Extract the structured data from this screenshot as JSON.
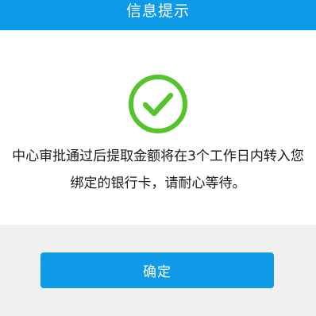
{
  "dialog": {
    "title": "信息提示",
    "icon": "success-check-icon",
    "message_line1": "中心审批通过后提取金额将在3个工作日内转入您",
    "message_line2": "绑定的银行卡，请耐心等待。",
    "confirm_label": "确定"
  },
  "colors": {
    "header": "#0d9be9",
    "button": "#109be9",
    "check": "#55c42b"
  }
}
